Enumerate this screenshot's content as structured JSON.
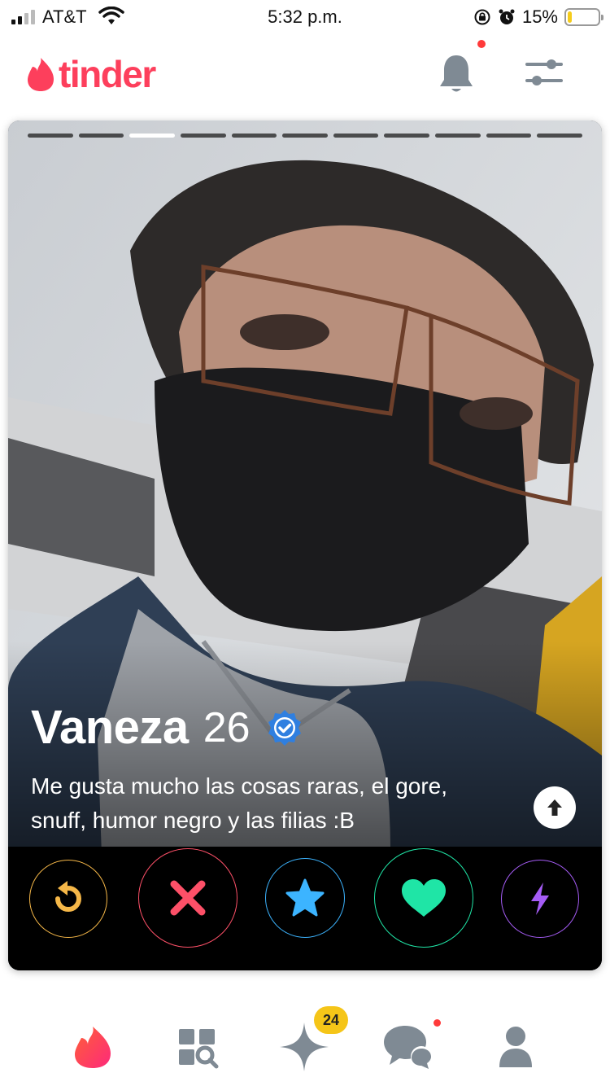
{
  "status_bar": {
    "carrier": "AT&T",
    "time": "5:32 p.m.",
    "battery_percent": "15%",
    "battery_level": 0.15,
    "icons": [
      "signal-icon",
      "wifi-icon",
      "orientation-lock-icon",
      "alarm-icon",
      "battery-icon"
    ]
  },
  "header": {
    "logo_text": "tinder",
    "icons": [
      "flame-logo-icon",
      "bell-icon",
      "filters-icon"
    ],
    "brand_color": "#fd3f5c"
  },
  "profile": {
    "name": "Vaneza",
    "age": "26",
    "verified": true,
    "bio": "Me gusta mucho las cosas raras, el gore, snuff, humor negro y las filias :B",
    "photo_count": 11,
    "active_photo": 3
  },
  "actions": [
    {
      "name": "rewind",
      "icon": "rewind-icon",
      "color": "#f5b748"
    },
    {
      "name": "nope",
      "icon": "close-icon",
      "color": "#fd5068"
    },
    {
      "name": "super-like",
      "icon": "star-icon",
      "color": "#3cb4ff"
    },
    {
      "name": "like",
      "icon": "heart-icon",
      "color": "#1fe5a6"
    },
    {
      "name": "boost",
      "icon": "boost-icon",
      "color": "#a55cf5"
    }
  ],
  "bottom_nav": {
    "items": [
      "home-flame-icon",
      "explore-icon",
      "gold-star-icon",
      "messages-icon",
      "profile-icon"
    ],
    "gold_badge": "24"
  }
}
